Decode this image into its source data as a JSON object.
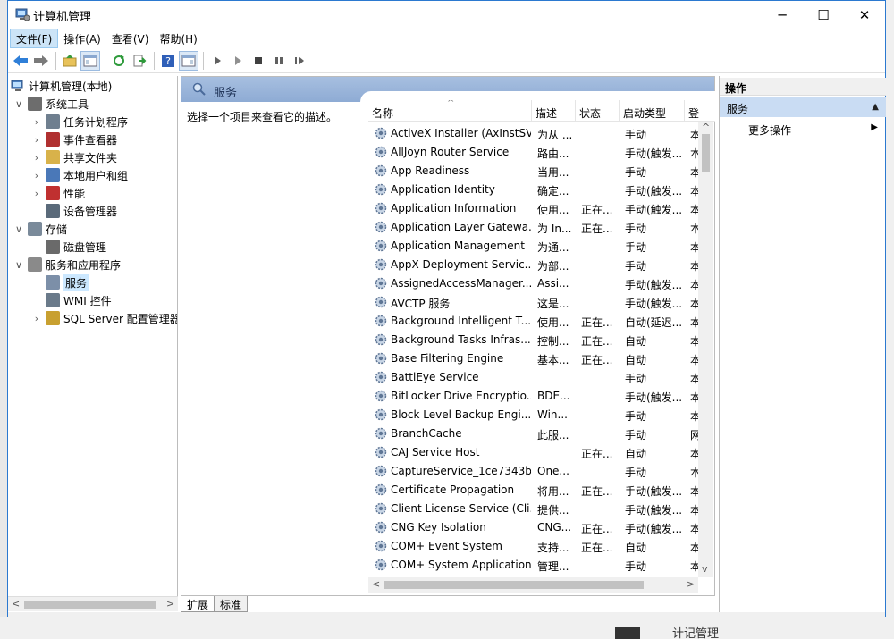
{
  "window": {
    "title": "计算机管理",
    "minimize": "─",
    "maximize": "☐",
    "close": "✕"
  },
  "menu": [
    {
      "label": "文件(F)",
      "active": true
    },
    {
      "label": "操作(A)",
      "active": false
    },
    {
      "label": "查看(V)",
      "active": false
    },
    {
      "label": "帮助(H)",
      "active": false
    }
  ],
  "tree": {
    "root": "计算机管理(本地)",
    "items": [
      {
        "label": "系统工具",
        "level": 1,
        "exp": "v",
        "icon": "tools-icon",
        "color": "#6d6d6d"
      },
      {
        "label": "任务计划程序",
        "level": 2,
        "exp": ">",
        "icon": "clock-icon",
        "color": "#6f7f8f"
      },
      {
        "label": "事件查看器",
        "level": 2,
        "exp": ">",
        "icon": "event-viewer-icon",
        "color": "#b03030"
      },
      {
        "label": "共享文件夹",
        "level": 2,
        "exp": ">",
        "icon": "shared-folder-icon",
        "color": "#d8b24a"
      },
      {
        "label": "本地用户和组",
        "level": 2,
        "exp": ">",
        "icon": "users-icon",
        "color": "#4a78b8"
      },
      {
        "label": "性能",
        "level": 2,
        "exp": ">",
        "icon": "performance-icon",
        "color": "#c03030"
      },
      {
        "label": "设备管理器",
        "level": 2,
        "exp": "",
        "icon": "device-manager-icon",
        "color": "#5a6a7a"
      },
      {
        "label": "存储",
        "level": 1,
        "exp": "v",
        "icon": "storage-icon",
        "color": "#7a8a9a"
      },
      {
        "label": "磁盘管理",
        "level": 2,
        "exp": "",
        "icon": "disk-icon",
        "color": "#6a6a6a"
      },
      {
        "label": "服务和应用程序",
        "level": 1,
        "exp": "v",
        "icon": "services-apps-icon",
        "color": "#8a8a8a"
      },
      {
        "label": "服务",
        "level": 2,
        "exp": "",
        "icon": "service-gear-icon",
        "color": "#7c8fa8",
        "selected": true
      },
      {
        "label": "WMI 控件",
        "level": 2,
        "exp": "",
        "icon": "wmi-icon",
        "color": "#6a7a8a"
      },
      {
        "label": "SQL Server 配置管理器",
        "level": 2,
        "exp": ">",
        "icon": "sql-server-icon",
        "color": "#c8a030"
      }
    ]
  },
  "center": {
    "title": "服务",
    "description_prompt": "选择一个项目来查看它的描述。",
    "columns": [
      "名称",
      "描述",
      "状态",
      "启动类型",
      "登"
    ],
    "rows": [
      {
        "name": "ActiveX Installer (AxInstSV)",
        "desc": "为从 ...",
        "status": "",
        "start": "手动",
        "logon": "本"
      },
      {
        "name": "AllJoyn Router Service",
        "desc": "路由...",
        "status": "",
        "start": "手动(触发...",
        "logon": "本"
      },
      {
        "name": "App Readiness",
        "desc": "当用...",
        "status": "",
        "start": "手动",
        "logon": "本"
      },
      {
        "name": "Application Identity",
        "desc": "确定...",
        "status": "",
        "start": "手动(触发...",
        "logon": "本"
      },
      {
        "name": "Application Information",
        "desc": "使用...",
        "status": "正在...",
        "start": "手动(触发...",
        "logon": "本"
      },
      {
        "name": "Application Layer Gatewa...",
        "desc": "为 In...",
        "status": "正在...",
        "start": "手动",
        "logon": "本"
      },
      {
        "name": "Application Management",
        "desc": "为通...",
        "status": "",
        "start": "手动",
        "logon": "本"
      },
      {
        "name": "AppX Deployment Servic...",
        "desc": "为部...",
        "status": "",
        "start": "手动",
        "logon": "本"
      },
      {
        "name": "AssignedAccessManager...",
        "desc": "Assi...",
        "status": "",
        "start": "手动(触发...",
        "logon": "本"
      },
      {
        "name": "AVCTP 服务",
        "desc": "这是...",
        "status": "",
        "start": "手动(触发...",
        "logon": "本"
      },
      {
        "name": "Background Intelligent T...",
        "desc": "使用...",
        "status": "正在...",
        "start": "自动(延迟...",
        "logon": "本"
      },
      {
        "name": "Background Tasks Infras...",
        "desc": "控制...",
        "status": "正在...",
        "start": "自动",
        "logon": "本"
      },
      {
        "name": "Base Filtering Engine",
        "desc": "基本...",
        "status": "正在...",
        "start": "自动",
        "logon": "本"
      },
      {
        "name": "BattlEye Service",
        "desc": "",
        "status": "",
        "start": "手动",
        "logon": "本"
      },
      {
        "name": "BitLocker Drive Encryptio...",
        "desc": "BDE...",
        "status": "",
        "start": "手动(触发...",
        "logon": "本"
      },
      {
        "name": "Block Level Backup Engi...",
        "desc": "Win...",
        "status": "",
        "start": "手动",
        "logon": "本"
      },
      {
        "name": "BranchCache",
        "desc": "此服...",
        "status": "",
        "start": "手动",
        "logon": "网"
      },
      {
        "name": "CAJ Service Host",
        "desc": "",
        "status": "正在...",
        "start": "自动",
        "logon": "本"
      },
      {
        "name": "CaptureService_1ce7343b",
        "desc": "One...",
        "status": "",
        "start": "手动",
        "logon": "本"
      },
      {
        "name": "Certificate Propagation",
        "desc": "将用...",
        "status": "正在...",
        "start": "手动(触发...",
        "logon": "本"
      },
      {
        "name": "Client License Service (Cli...",
        "desc": "提供...",
        "status": "",
        "start": "手动(触发...",
        "logon": "本"
      },
      {
        "name": "CNG Key Isolation",
        "desc": "CNG...",
        "status": "正在...",
        "start": "手动(触发...",
        "logon": "本"
      },
      {
        "name": "COM+ Event System",
        "desc": "支持...",
        "status": "正在...",
        "start": "自动",
        "logon": "本"
      },
      {
        "name": "COM+ System Application",
        "desc": "管理...",
        "status": "",
        "start": "手动",
        "logon": "本"
      }
    ]
  },
  "tabs": [
    "扩展",
    "标准"
  ],
  "actions": {
    "header": "操作",
    "section": "服务",
    "items": [
      "更多操作"
    ]
  },
  "background_text": "计记管理"
}
